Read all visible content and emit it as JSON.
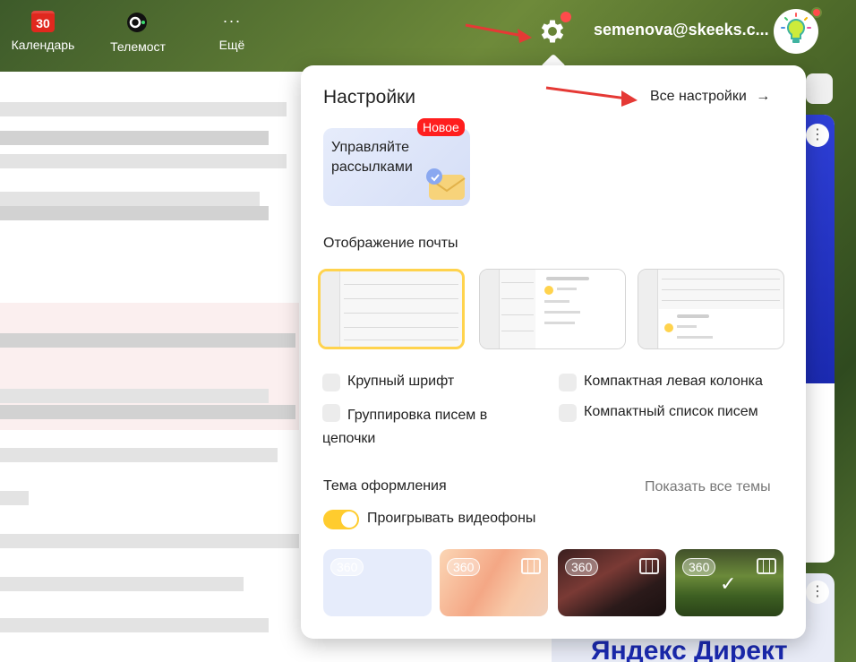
{
  "header": {
    "apps": [
      {
        "label": "Календарь",
        "icon": "calendar-icon",
        "badge": "30"
      },
      {
        "label": "Телемост",
        "icon": "telemost-icon"
      },
      {
        "label": "Ещё",
        "icon": "more-icon",
        "glyph": "···"
      }
    ],
    "user_email": "semenova@skeeks.c...",
    "accent": "#ff4b4b"
  },
  "settings_panel": {
    "title": "Настройки",
    "all_settings_link": "Все настройки",
    "all_settings_arrow": "→",
    "promo": {
      "text": "Управляйте рассылками",
      "badge": "Новое"
    },
    "mail_display": {
      "title": "Отображение почты",
      "options": [
        {
          "name": "list",
          "selected": true
        },
        {
          "name": "two-pane",
          "selected": false
        },
        {
          "name": "preview-bottom",
          "selected": false
        }
      ]
    },
    "checkboxes": {
      "large_font": {
        "label": "Крупный шрифт",
        "checked": false
      },
      "group_threads": {
        "label": "Группировка писем в цепочки",
        "checked": false
      },
      "compact_left_column": {
        "label": "Компактная левая колонка",
        "checked": false
      },
      "compact_list": {
        "label": "Компактный список писем",
        "checked": false
      }
    },
    "theme": {
      "title": "Тема оформления",
      "show_all": "Показать все темы",
      "video_toggle": {
        "label": "Проигрывать видеофоны",
        "on": true
      },
      "themes": [
        {
          "badge": "360",
          "name": "light-blue",
          "video": false,
          "selected": false
        },
        {
          "badge": "360",
          "name": "peach",
          "video": true,
          "selected": false
        },
        {
          "badge": "360",
          "name": "dark",
          "video": true,
          "selected": false
        },
        {
          "badge": "360",
          "name": "grass",
          "video": true,
          "selected": true,
          "check": "✓"
        }
      ]
    }
  },
  "ads": {
    "bottom_brand": "Яндекс Директ",
    "menu_glyph": "⋮"
  }
}
